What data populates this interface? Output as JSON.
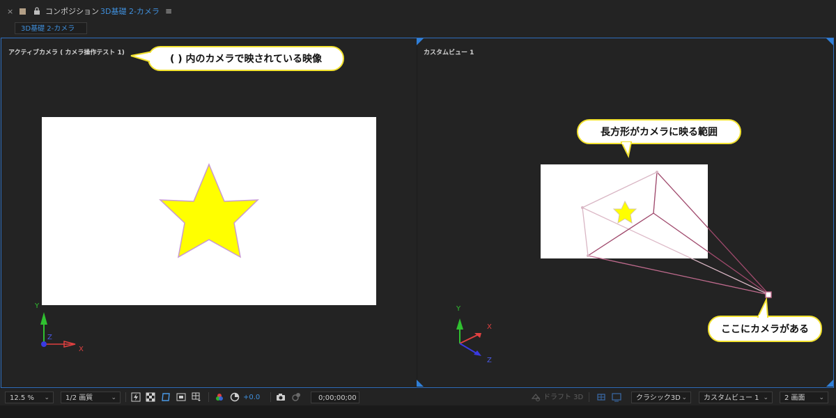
{
  "header": {
    "close_symbol": "×",
    "comp_label": "コンポジション",
    "comp_name": "3D基礎 2-カメラ",
    "menu_symbol": "≡",
    "subtab_label": "3D基礎 2-カメラ"
  },
  "left_view": {
    "label": "アクティブカメラ ( カメラ操作テスト 1)",
    "callout": "( ) 内のカメラで映されている映像",
    "axis": {
      "x": "X",
      "y": "Y",
      "z": "Z"
    }
  },
  "right_view": {
    "label": "カスタムビュー 1",
    "callout_range": "長方形がカメラに映る範囲",
    "callout_camera": "ここにカメラがある",
    "axis": {
      "x": "X",
      "y": "Y",
      "z": "Z"
    }
  },
  "toolbar": {
    "zoom": "12.5 %",
    "resolution": "1/2 画質",
    "exposure": "+0.0",
    "timecode": "0;00;00;00",
    "draft3d": "ドラフト 3D",
    "renderer": "クラシック3D",
    "view": "カスタムビュー 1",
    "layout": "2 画面"
  },
  "colors": {
    "accent": "#3f8fdc",
    "callout_border": "#f2e22f",
    "star_fill": "#ffff00",
    "camera_lines": "#b0577a"
  },
  "icons": [
    "close-icon",
    "color-label-icon",
    "lock-icon",
    "panel-menu-icon",
    "chevron-down-icon",
    "fast-preview-icon",
    "transparency-grid-icon",
    "mask-path-icon",
    "region-of-interest-icon",
    "guides-icon",
    "color-channels-icon",
    "exposure-reset-icon",
    "snapshot-icon",
    "show-snapshot-icon",
    "draft-3d-icon",
    "3d-ground-icon",
    "extended-viewer-icon"
  ]
}
